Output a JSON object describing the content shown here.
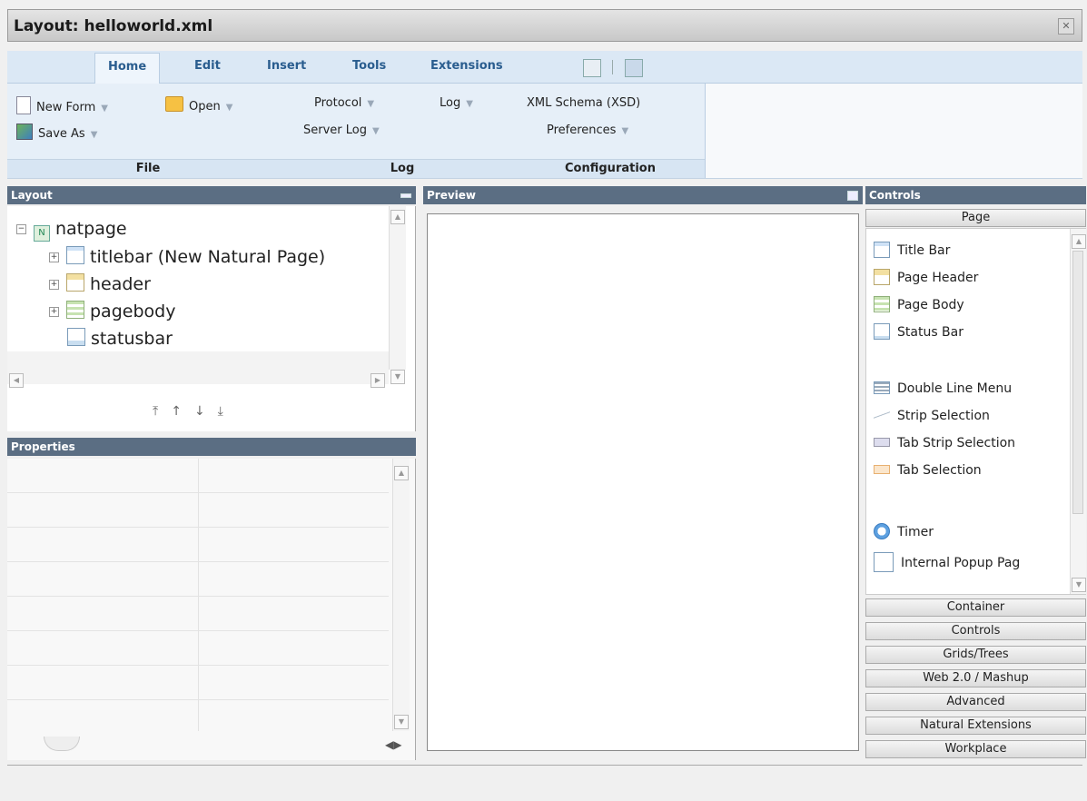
{
  "window": {
    "title": "Layout: helloworld.xml"
  },
  "menu": {
    "tabs": [
      {
        "label": "Home"
      },
      {
        "label": "Edit"
      },
      {
        "label": "Insert"
      },
      {
        "label": "Tools"
      },
      {
        "label": "Extensions"
      }
    ]
  },
  "ribbon": {
    "file": {
      "new_form": "New Form",
      "open": "Open",
      "save_as": "Save As",
      "label": "File"
    },
    "log": {
      "protocol": "Protocol",
      "log": "Log",
      "server_log": "Server Log",
      "label": "Log"
    },
    "config": {
      "xml_schema": "XML Schema (XSD)",
      "preferences": "Preferences",
      "label": "Configuration"
    }
  },
  "layout_panel": {
    "title": "Layout",
    "tree": {
      "root": "natpage",
      "root_icon_letter": "N",
      "children": [
        "titlebar (New Natural Page)",
        "header",
        "pagebody",
        "statusbar"
      ]
    }
  },
  "properties_panel": {
    "title": "Properties"
  },
  "preview_panel": {
    "title": "Preview"
  },
  "controls_panel": {
    "title": "Controls",
    "active_category": "Page",
    "items": [
      "Title Bar",
      "Page Header",
      "Page Body",
      "Status Bar",
      "Double Line Menu",
      "Strip Selection",
      "Tab Strip Selection",
      "Tab Selection",
      "Timer",
      "Internal Popup Pag"
    ],
    "categories": [
      "Container",
      "Controls",
      "Grids/Trees",
      "Web 2.0 / Mashup",
      "Advanced",
      "Natural Extensions",
      "Workplace"
    ]
  }
}
